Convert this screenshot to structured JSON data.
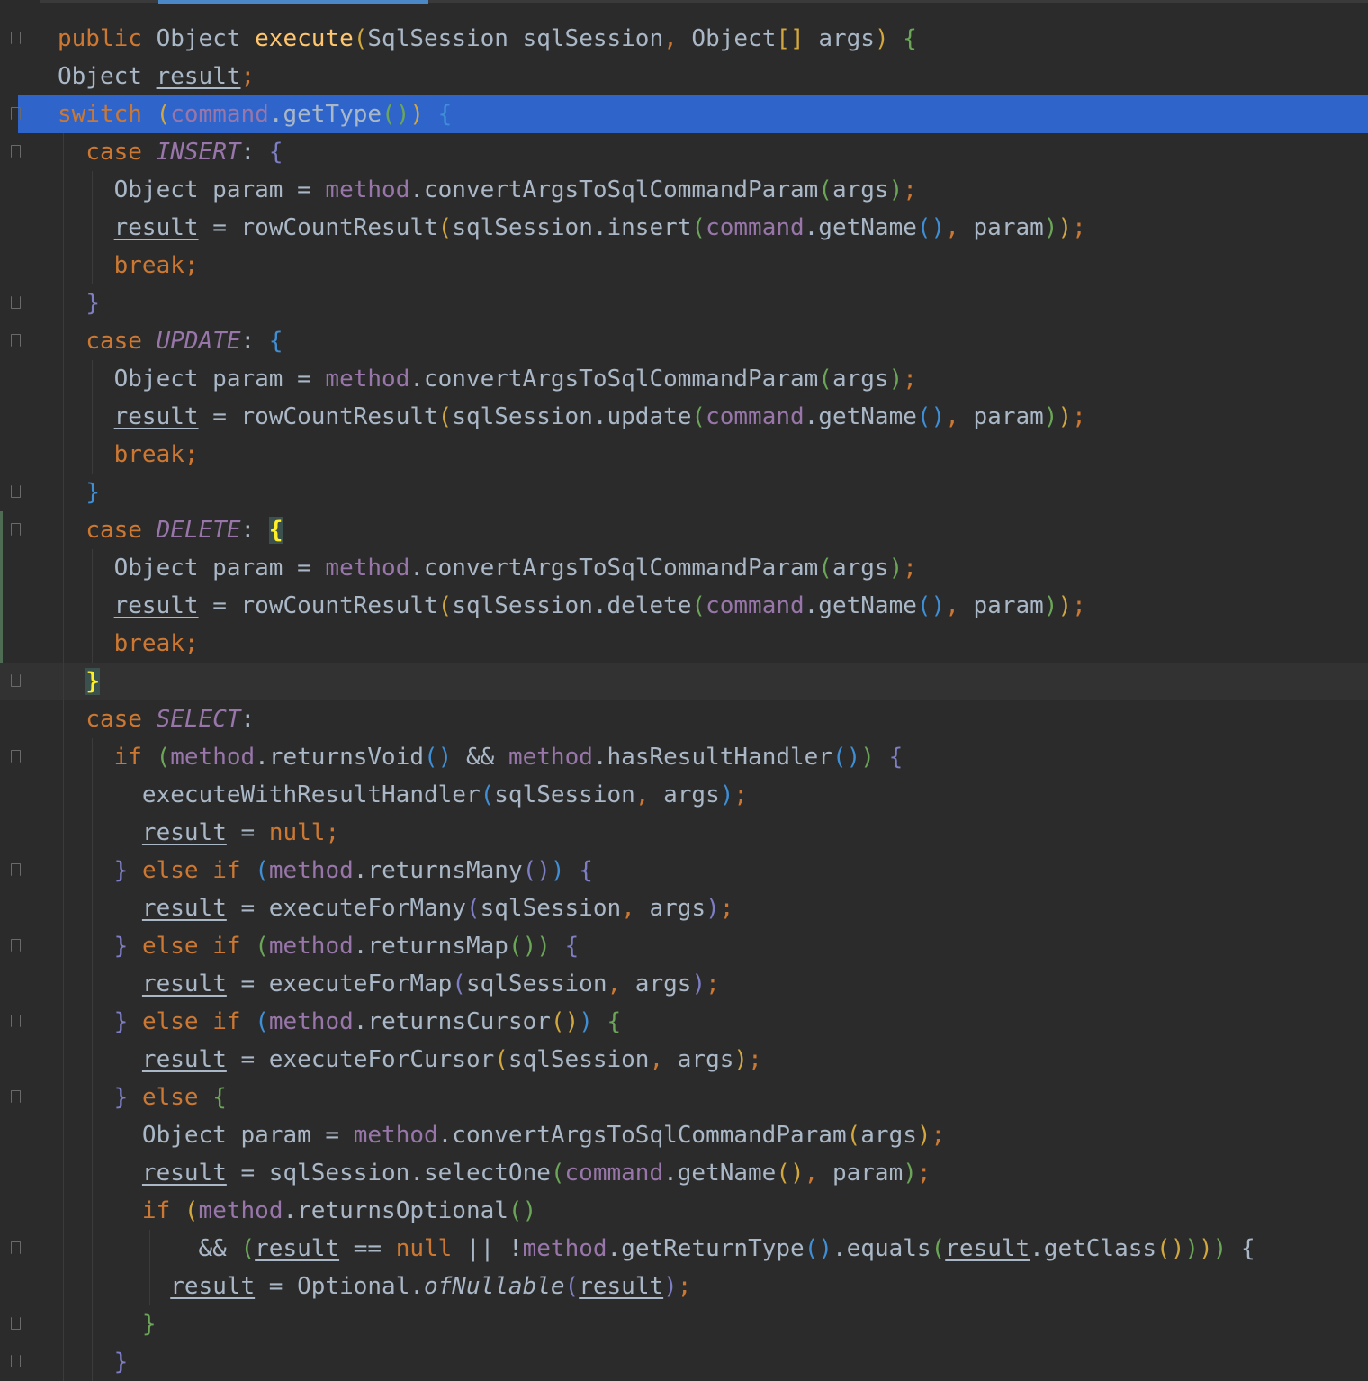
{
  "editor": {
    "language": "Java",
    "selected_line": 3,
    "caret_line": 18,
    "lines": [
      {
        "n": 1,
        "text": "public Object execute(SqlSession sqlSession, Object[] args) {"
      },
      {
        "n": 2,
        "text": "  Object result;"
      },
      {
        "n": 3,
        "text": "  switch (command.getType()) {"
      },
      {
        "n": 4,
        "text": "    case INSERT: {"
      },
      {
        "n": 5,
        "text": "      Object param = method.convertArgsToSqlCommandParam(args);"
      },
      {
        "n": 6,
        "text": "      result = rowCountResult(sqlSession.insert(command.getName(), param));"
      },
      {
        "n": 7,
        "text": "      break;"
      },
      {
        "n": 8,
        "text": "    }"
      },
      {
        "n": 9,
        "text": "    case UPDATE: {"
      },
      {
        "n": 10,
        "text": "      Object param = method.convertArgsToSqlCommandParam(args);"
      },
      {
        "n": 11,
        "text": "      result = rowCountResult(sqlSession.update(command.getName(), param));"
      },
      {
        "n": 12,
        "text": "      break;"
      },
      {
        "n": 13,
        "text": "    }"
      },
      {
        "n": 14,
        "text": "    case DELETE: {"
      },
      {
        "n": 15,
        "text": "      Object param = method.convertArgsToSqlCommandParam(args);"
      },
      {
        "n": 16,
        "text": "      result = rowCountResult(sqlSession.delete(command.getName(), param));"
      },
      {
        "n": 17,
        "text": "      break;"
      },
      {
        "n": 18,
        "text": "    }"
      },
      {
        "n": 19,
        "text": "    case SELECT:"
      },
      {
        "n": 20,
        "text": "      if (method.returnsVoid() && method.hasResultHandler()) {"
      },
      {
        "n": 21,
        "text": "        executeWithResultHandler(sqlSession, args);"
      },
      {
        "n": 22,
        "text": "        result = null;"
      },
      {
        "n": 23,
        "text": "      } else if (method.returnsMany()) {"
      },
      {
        "n": 24,
        "text": "        result = executeForMany(sqlSession, args);"
      },
      {
        "n": 25,
        "text": "      } else if (method.returnsMap()) {"
      },
      {
        "n": 26,
        "text": "        result = executeForMap(sqlSession, args);"
      },
      {
        "n": 27,
        "text": "      } else if (method.returnsCursor()) {"
      },
      {
        "n": 28,
        "text": "        result = executeForCursor(sqlSession, args);"
      },
      {
        "n": 29,
        "text": "      } else {"
      },
      {
        "n": 30,
        "text": "        Object param = method.convertArgsToSqlCommandParam(args);"
      },
      {
        "n": 31,
        "text": "        result = sqlSession.selectOne(command.getName(), param);"
      },
      {
        "n": 32,
        "text": "        if (method.returnsOptional()"
      },
      {
        "n": 33,
        "text": "            && (result == null || !method.getReturnType().equals(result.getClass()))) {"
      },
      {
        "n": 34,
        "text": "          result = Optional.ofNullable(result);"
      },
      {
        "n": 35,
        "text": "        }"
      },
      {
        "n": 36,
        "text": "      }"
      }
    ]
  },
  "colors": {
    "background": "#2b2b2b",
    "selection": "#2f65ca",
    "caret_row": "#323232",
    "keyword": "#cc7832",
    "method_decl": "#ffc66d",
    "field": "#9876aa",
    "plain": "#a9b7c6"
  }
}
